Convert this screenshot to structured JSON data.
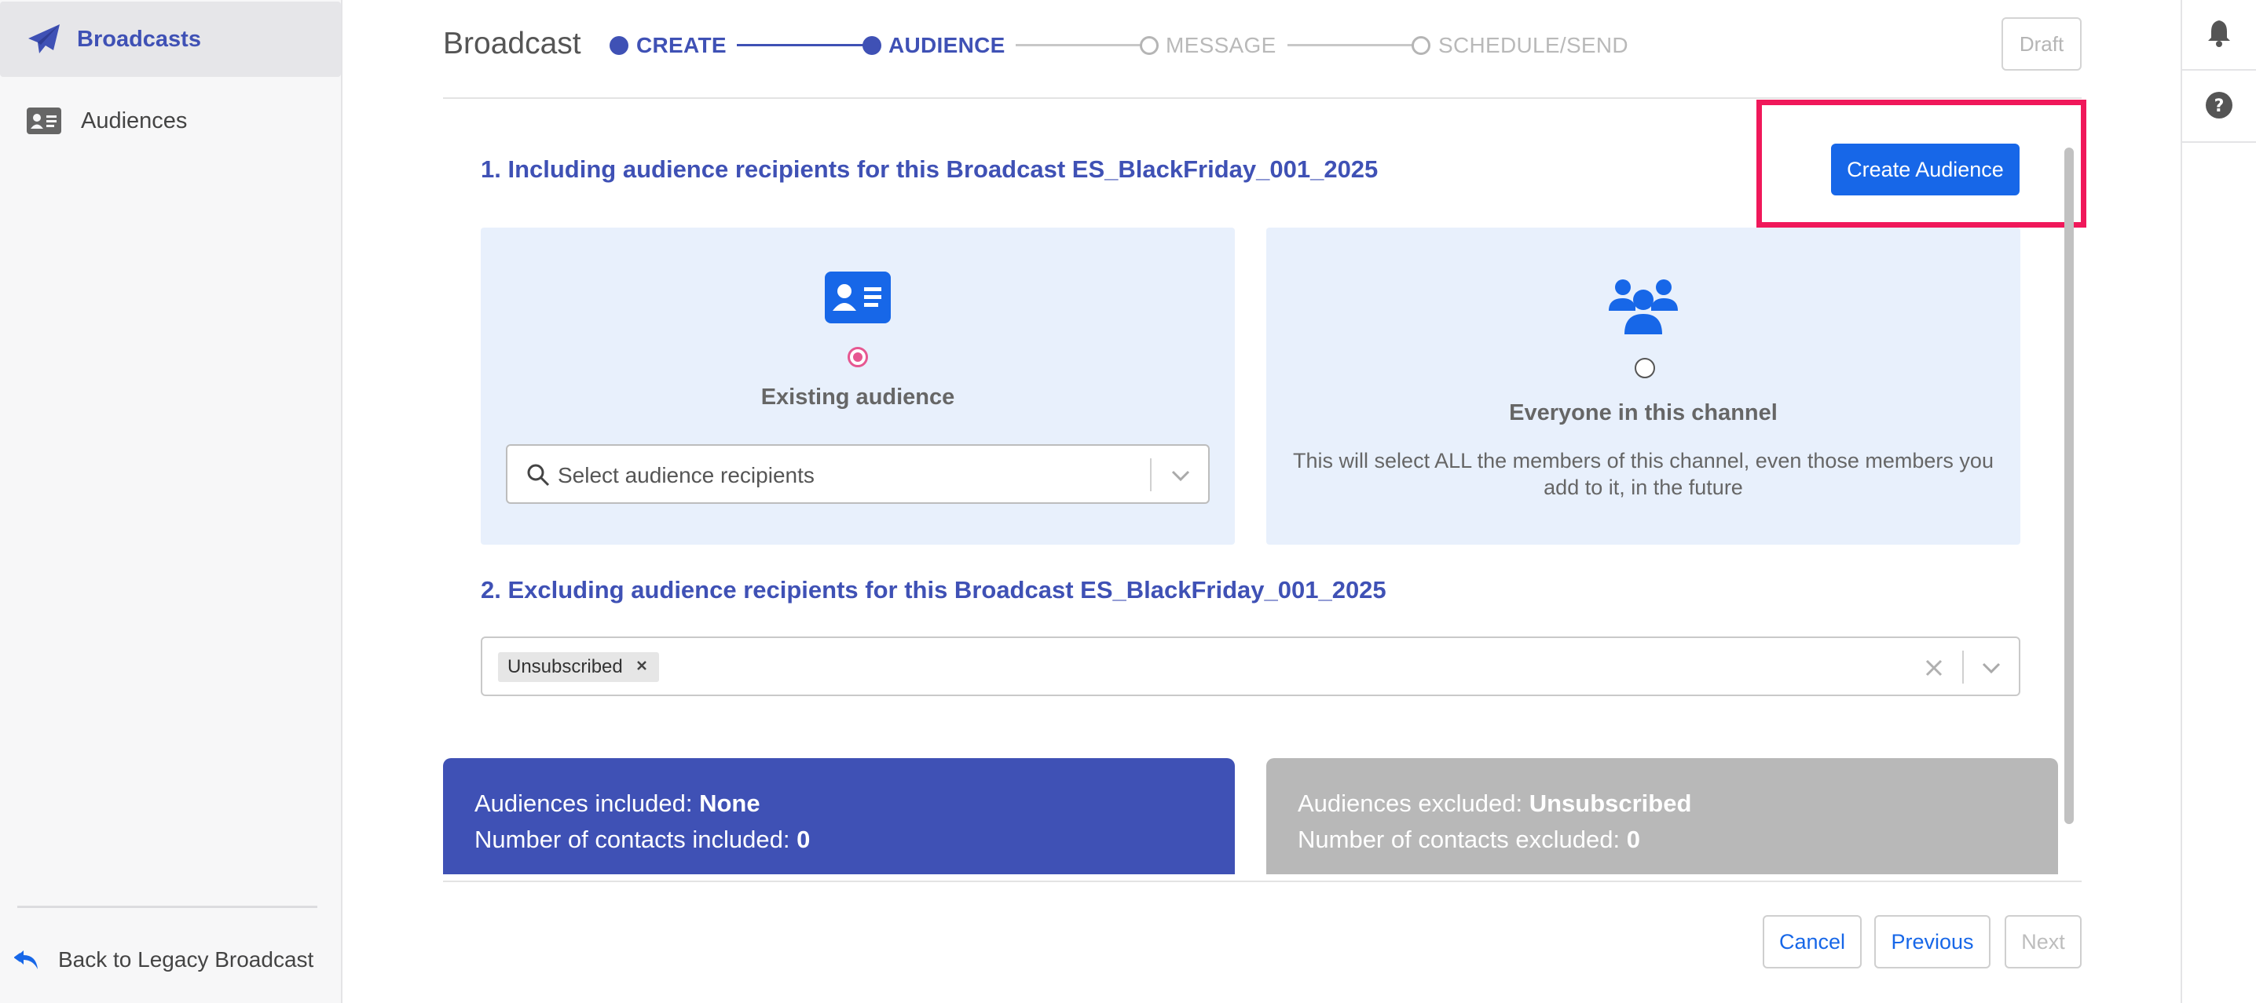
{
  "sidebar": {
    "items": [
      {
        "label": "Broadcasts",
        "icon": "paper-plane-icon",
        "active": true
      },
      {
        "label": "Audiences",
        "icon": "id-card-icon",
        "active": false
      }
    ],
    "back_link": {
      "label": "Back to Legacy Broadcast",
      "icon": "reply-icon"
    }
  },
  "header": {
    "title": "Broadcast",
    "steps": [
      {
        "label": "CREATE",
        "state": "done"
      },
      {
        "label": "AUDIENCE",
        "state": "current"
      },
      {
        "label": "MESSAGE",
        "state": "todo"
      },
      {
        "label": "SCHEDULE/SEND",
        "state": "todo"
      }
    ],
    "status_badge": "Draft"
  },
  "include_section": {
    "title": "1. Including audience recipients for this Broadcast ES_BlackFriday_001_2025",
    "create_button": "Create Audience",
    "existing_card": {
      "title": "Existing audience",
      "selected": true,
      "select_placeholder": "Select audience recipients"
    },
    "everyone_card": {
      "title": "Everyone in this channel",
      "selected": false,
      "description": "This will select ALL the members of this channel, even those members you add to it, in the future"
    }
  },
  "exclude_section": {
    "title": "2. Excluding audience recipients for this Broadcast ES_BlackFriday_001_2025",
    "chips": [
      "Unsubscribed"
    ]
  },
  "summary": {
    "included": {
      "audiences_label": "Audiences included: ",
      "audiences_value": "None",
      "contacts_label": "Number of contacts included: ",
      "contacts_value": "0"
    },
    "excluded": {
      "audiences_label": "Audiences excluded: ",
      "audiences_value": "Unsubscribed",
      "contacts_label": "Number of contacts excluded: ",
      "contacts_value": "0"
    }
  },
  "footer": {
    "cancel": "Cancel",
    "previous": "Previous",
    "next": "Next"
  },
  "colors": {
    "primary": "#3f51b5",
    "accent_button": "#1767e8",
    "highlight": "#f0185a",
    "included_bg": "#3f51b5",
    "excluded_bg": "#b8b8b8",
    "card_bg": "#e8f0fc"
  }
}
